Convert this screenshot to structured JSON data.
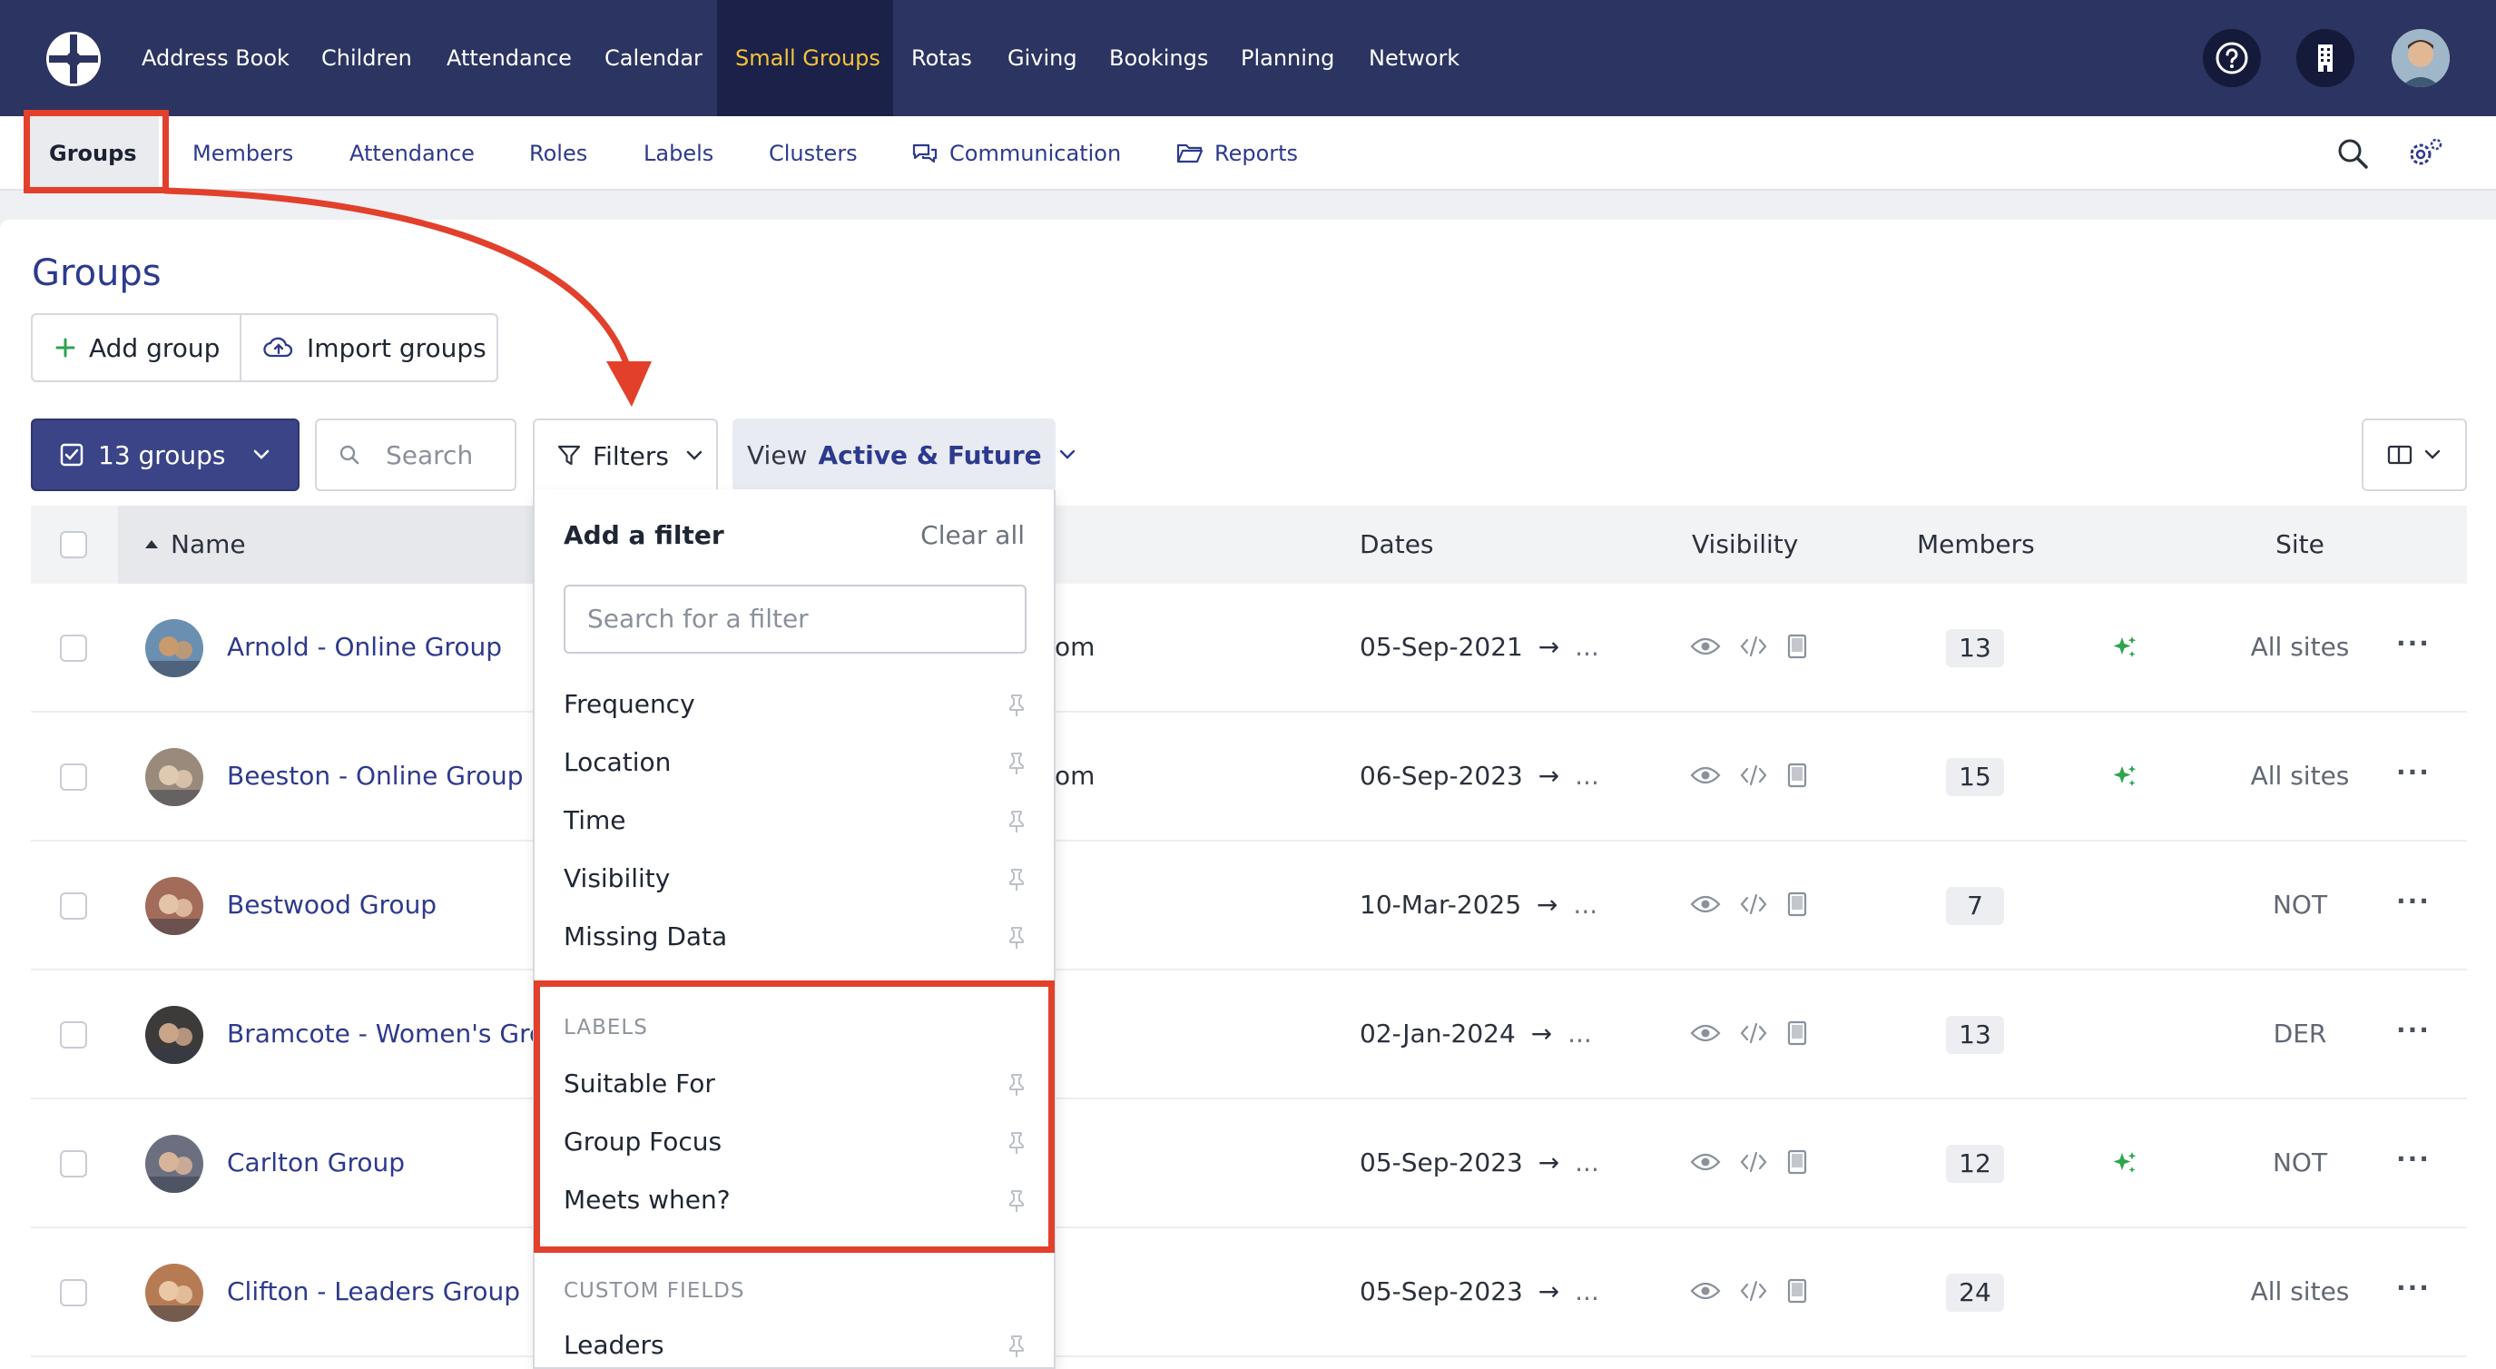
{
  "topnav": {
    "items": [
      {
        "label": "Address Book"
      },
      {
        "label": "Children"
      },
      {
        "label": "Attendance"
      },
      {
        "label": "Calendar"
      },
      {
        "label": "Small Groups",
        "active": true
      },
      {
        "label": "Rotas"
      },
      {
        "label": "Giving"
      },
      {
        "label": "Bookings"
      },
      {
        "label": "Planning"
      },
      {
        "label": "Network"
      }
    ],
    "icons": [
      "help-icon",
      "building-icon",
      "user-avatar"
    ]
  },
  "subnav": {
    "items": [
      {
        "label": "Groups",
        "active": true
      },
      {
        "label": "Members"
      },
      {
        "label": "Attendance"
      },
      {
        "label": "Roles"
      },
      {
        "label": "Labels"
      },
      {
        "label": "Clusters"
      },
      {
        "label": "Communication",
        "icon": "chat-icon"
      },
      {
        "label": "Reports",
        "icon": "folder-icon"
      }
    ],
    "icons": [
      "search-icon",
      "settings-icon"
    ]
  },
  "page": {
    "title": "Groups",
    "add_group": "Add group",
    "import_groups": "Import groups",
    "group_count": "13 groups",
    "search_placeholder": "Search",
    "filters_label": "Filters",
    "view_label": "View",
    "view_value": "Active & Future"
  },
  "table": {
    "columns": {
      "name": "Name",
      "dates": "Dates",
      "visibility": "Visibility",
      "members": "Members",
      "site": "Site"
    },
    "rows": [
      {
        "name": "Arnold - Online Group",
        "tail": "om",
        "dates": "05-Sep-2021",
        "dates_end": "...",
        "members": "13",
        "spark": true,
        "site": "All sites"
      },
      {
        "name": "Beeston - Online Group",
        "tail": "om",
        "dates": "06-Sep-2023",
        "dates_end": "...",
        "members": "15",
        "spark": true,
        "site": "All sites"
      },
      {
        "name": "Bestwood Group",
        "tail": "",
        "dates": "10-Mar-2025",
        "dates_end": "...",
        "members": "7",
        "spark": false,
        "site": "NOT"
      },
      {
        "name": "Bramcote - Women's Grou",
        "tail": "",
        "dates": "02-Jan-2024",
        "dates_end": "...",
        "members": "13",
        "spark": false,
        "site": "DER"
      },
      {
        "name": "Carlton Group",
        "tail": "",
        "dates": "05-Sep-2023",
        "dates_end": "...",
        "members": "12",
        "spark": true,
        "site": "NOT"
      },
      {
        "name": "Clifton - Leaders Group",
        "tail": "",
        "dates": "05-Sep-2023",
        "dates_end": "...",
        "members": "24",
        "spark": false,
        "site": "All sites"
      }
    ],
    "arrow": "→",
    "more": "···"
  },
  "filter_dropdown": {
    "title": "Add a filter",
    "clear_all": "Clear all",
    "search_placeholder": "Search for a filter",
    "general_items": [
      "Frequency",
      "Location",
      "Time",
      "Visibility",
      "Missing Data"
    ],
    "labels_heading": "LABELS",
    "label_items": [
      "Suitable For",
      "Group Focus",
      "Meets when?"
    ],
    "custom_heading": "CUSTOM FIELDS",
    "custom_items": [
      "Leaders"
    ]
  },
  "colors": {
    "nav_bg": "#2c3461",
    "active_nav_text": "#f4c33b",
    "link": "#2e3a8c",
    "annotation": "#e2402b",
    "accent_green": "#2ea44f"
  }
}
